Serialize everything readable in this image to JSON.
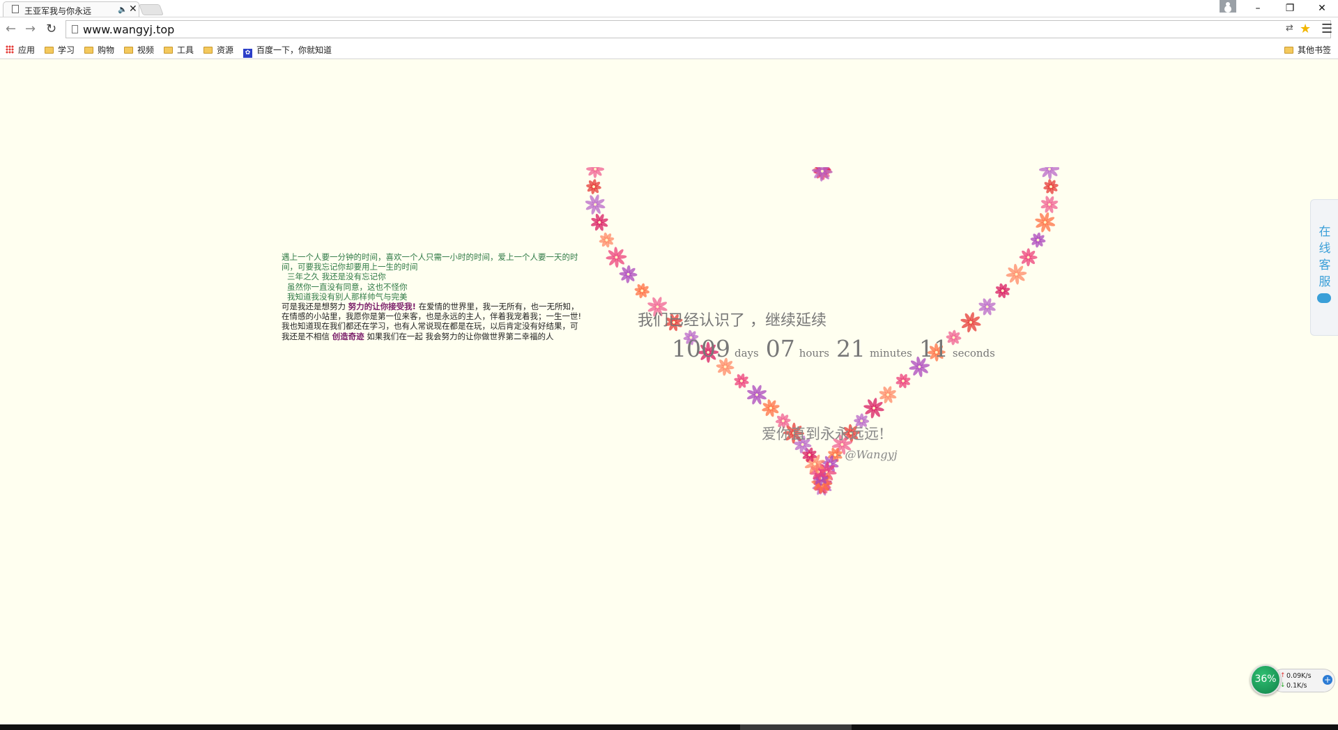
{
  "browser": {
    "tab_title": "王亚军我与你永远",
    "tab_audio_icon": "speaker-icon",
    "url": "www.wangyj.top",
    "window_controls": {
      "minimize": "–",
      "restore": "❐",
      "close": "✕"
    },
    "bookmarks": [
      {
        "label": "应用",
        "icon": "apps-grid-icon"
      },
      {
        "label": "学习",
        "icon": "folder-icon"
      },
      {
        "label": "购物",
        "icon": "folder-icon"
      },
      {
        "label": "视频",
        "icon": "folder-icon"
      },
      {
        "label": "工具",
        "icon": "folder-icon"
      },
      {
        "label": "资源",
        "icon": "folder-icon"
      },
      {
        "label": "百度一下，你就知道",
        "icon": "baidu-paw-icon"
      }
    ],
    "other_bookmarks": "其他书签"
  },
  "story": {
    "line1": "遇上一个人要一分钟的时间，喜欢一个人只需一小时的时间，爱上一个人要一天的时间，可要我忘记你却要用上一生的时间",
    "line2": "三年之久  我还是没有忘记你",
    "line3": "虽然你一直没有同意，这也不怪你",
    "line4": "我知道我没有别人那样帅气与完美",
    "line5_a": "可是我还是想努力",
    "line5_hl": "努力的让你接受我!",
    "line5_b": "在爱情的世界里，我一无所有，也一无所知，在情感的小站里，我愿你是第一位来客，也是永远的主人，伴着我宠着我；一生一世!",
    "line6_a": "我也知道现在我们都还在学习，也有人常说现在都是在玩，以后肯定没有好结果，可我还是不相信",
    "line6_hl": "创造奇迹",
    "line6_b": "如果我们在一起  我会努力的让你做世界第二幸福的人"
  },
  "counter": {
    "title": "我们已经认识了 ，继续延续",
    "days": "1009",
    "days_label": "days",
    "hours": "07",
    "hours_label": "hours",
    "minutes": "21",
    "minutes_label": "minutes",
    "seconds": "11",
    "seconds_label": "seconds"
  },
  "love": {
    "message": "爱你直到永永远远!",
    "signature": "- @Wangyj"
  },
  "service": {
    "label": "在线客服",
    "icon": "chat-bubble-icon"
  },
  "netmon": {
    "percent": "36%",
    "upload": "0.09K/s",
    "download": "0.1K/s"
  },
  "colors": {
    "page_bg": "#fffff0",
    "story_green": "#2f7a46",
    "story_highlight": "#7a1e6a",
    "counter_text": "#777777",
    "service_blue": "#3a9fd8",
    "heart_petals": [
      "#e53935",
      "#f06292",
      "#ff7043",
      "#ab47bc",
      "#ec407a",
      "#ff8a65",
      "#d81b60",
      "#ba68c8"
    ]
  }
}
